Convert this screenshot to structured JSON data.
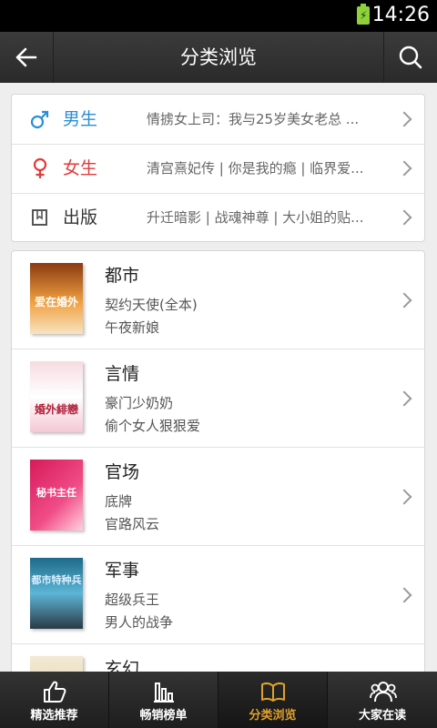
{
  "status_bar": {
    "time": "14:26"
  },
  "header": {
    "title": "分类浏览"
  },
  "categories": [
    {
      "name": "男生",
      "icon": "male-icon",
      "books": "情掳女上司：我与25岁美女老总 ...",
      "color": "#2a8fd6"
    },
    {
      "name": "女生",
      "icon": "female-icon",
      "books": "清宫熹妃传 | 你是我的瘾 | 临界爱...",
      "color": "#e23a3a"
    },
    {
      "name": "出版",
      "icon": "book-icon",
      "books": "升迁暗影 | 战魂神尊 | 大小姐的贴...",
      "color": "#333333"
    }
  ],
  "genres": [
    {
      "name": "都市",
      "books": [
        "契约天使(全本)",
        "午夜新娘"
      ],
      "cover_text": "爱在婚外"
    },
    {
      "name": "言情",
      "books": [
        "豪门少奶奶",
        "偷个女人狠狠爱"
      ],
      "cover_text": "婚外緋戀"
    },
    {
      "name": "官场",
      "books": [
        "底牌",
        "官路风云"
      ],
      "cover_text": "秘书主任"
    },
    {
      "name": "军事",
      "books": [
        "超级兵王",
        "男人的战争"
      ],
      "cover_text": "都市特种兵"
    },
    {
      "name": "玄幻",
      "books": [],
      "cover_text": ""
    }
  ],
  "bottom_nav": [
    {
      "label": "精选推荐",
      "icon": "thumbs-up-icon"
    },
    {
      "label": "畅销榜单",
      "icon": "bar-chart-icon"
    },
    {
      "label": "分类浏览",
      "icon": "open-book-icon"
    },
    {
      "label": "大家在读",
      "icon": "people-icon"
    }
  ],
  "colors": {
    "accent": "#e0a12a",
    "battery": "#8fd13a"
  }
}
